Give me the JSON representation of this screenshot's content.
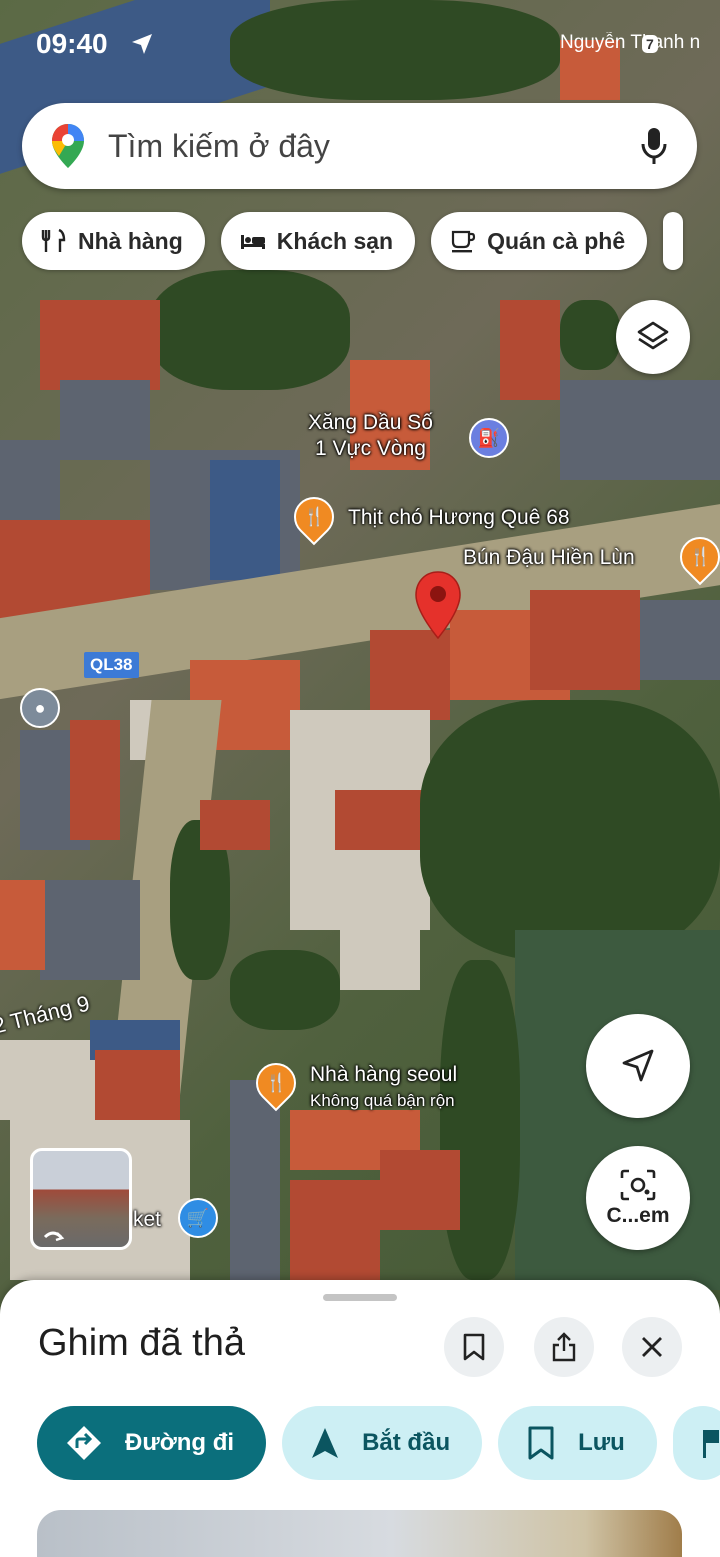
{
  "status_bar": {
    "time": "09:40",
    "right_text": "Nguyễn Thanh n",
    "battery": "7"
  },
  "search": {
    "placeholder": "Tìm kiếm ở đây"
  },
  "chips": [
    {
      "label": "Nhà hàng",
      "icon": "restaurant-icon"
    },
    {
      "label": "Khách sạn",
      "icon": "hotel-icon"
    },
    {
      "label": "Quán cà phê",
      "icon": "coffee-icon"
    }
  ],
  "map": {
    "road_shield": "QL38",
    "road_name": "2 Tháng 9",
    "places": [
      {
        "line1": "Xăng Dầu Số",
        "line2": "1 Vực Vòng",
        "icon": "gas-station-icon"
      },
      {
        "line1": "Thịt chó Hương Quê 68",
        "icon": "restaurant-icon"
      },
      {
        "line1": "Bún Đậu Hiền Lùn",
        "icon": "restaurant-icon"
      },
      {
        "line1": "Nhà hàng seoul",
        "line2": "Không quá bận rộn",
        "icon": "restaurant-icon"
      },
      {
        "line1": "ket",
        "icon": "shopping-cart-icon"
      }
    ],
    "lens_label": "C...em"
  },
  "sheet": {
    "title": "Ghim đã thả",
    "actions": [
      {
        "label": "Đường đi",
        "icon": "directions-icon"
      },
      {
        "label": "Bắt đầu",
        "icon": "navigation-arrow-icon"
      },
      {
        "label": "Lưu",
        "icon": "bookmark-icon"
      }
    ]
  },
  "colors": {
    "primary_action": "#0b6f7c",
    "secondary_action": "#cdeff4",
    "pin_red": "#e5312b",
    "food_poi": "#f08a22"
  }
}
